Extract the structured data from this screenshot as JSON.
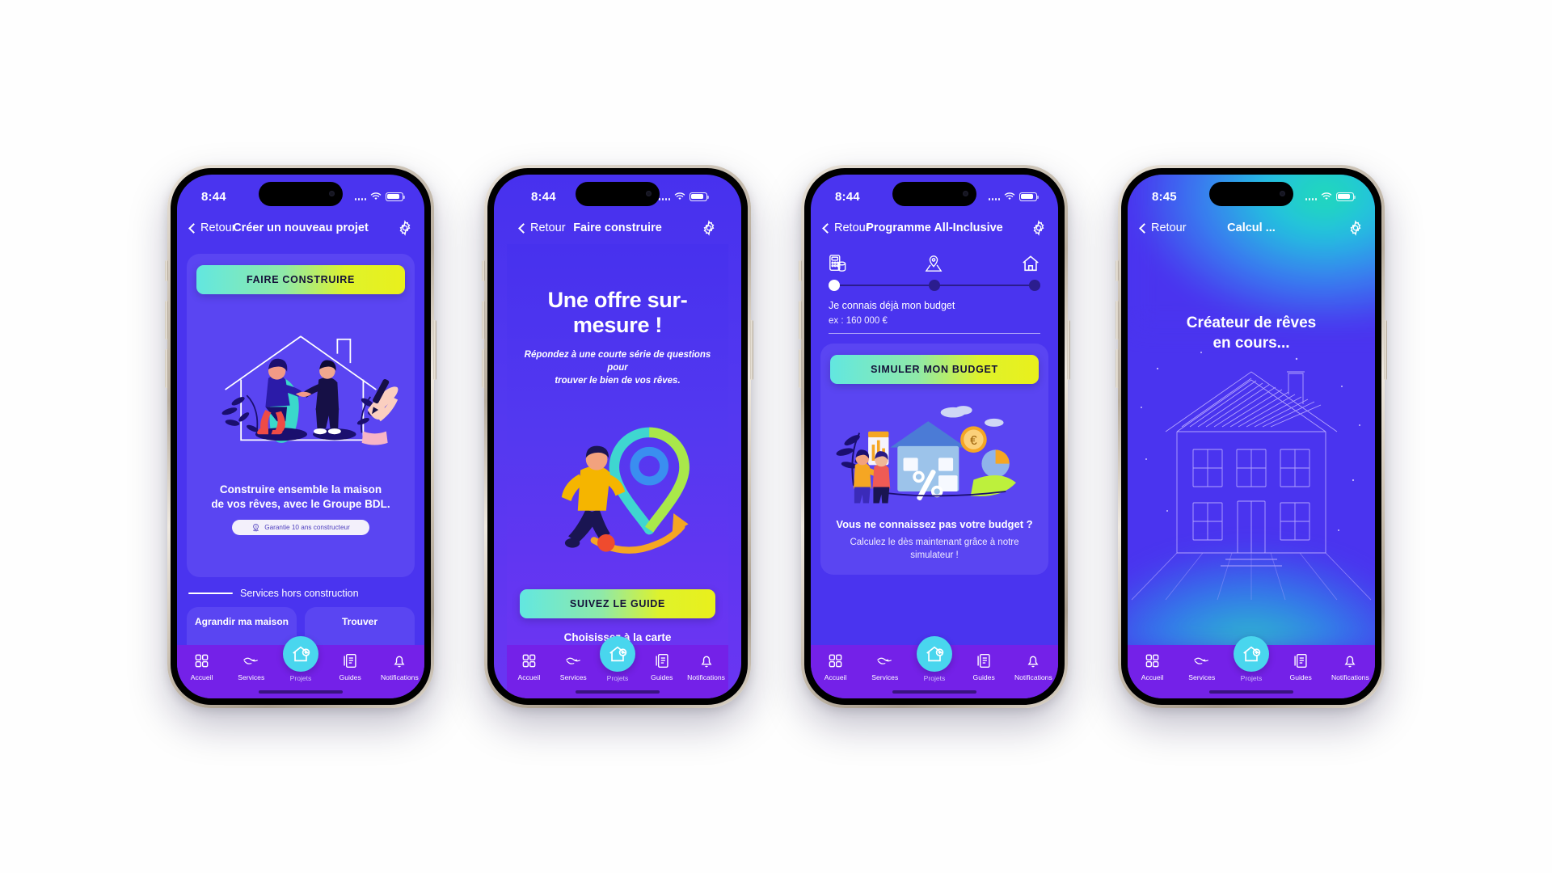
{
  "tabbar": {
    "items": [
      {
        "label": "Accueil",
        "icon": "grid-icon",
        "active": false
      },
      {
        "label": "Services",
        "icon": "handshake-icon",
        "active": false
      },
      {
        "label": "Projets",
        "icon": "house-plus-icon",
        "active": true
      },
      {
        "label": "Guides",
        "icon": "book-icon",
        "active": false
      },
      {
        "label": "Notifications",
        "icon": "bell-icon",
        "active": false
      }
    ],
    "background": "#7421e8",
    "active_bubble_color": "#49d6ee"
  },
  "common": {
    "back_label": "Retour",
    "settings_icon": "gear-icon",
    "back_icon": "chevron-left-icon",
    "wifi_icon": "wifi-icon",
    "battery_icon": "battery-icon"
  },
  "screens": [
    {
      "id": "creer-projet",
      "status_time": "8:44",
      "nav_title": "Créer un nouveau projet",
      "cta_label": "FAIRE CONSTRUIRE",
      "headline": "Construire ensemble la maison\nde vos rêves, avec le Groupe BDL.",
      "headline_line1": "Construire ensemble la maison",
      "headline_line2": "de vos rêves, avec le Groupe BDL.",
      "badge_label": "Garantie 10 ans constructeur",
      "badge_icon": "medal-10-icon",
      "section_divider": "Services hors construction",
      "tiles": [
        {
          "label": "Agrandir ma maison"
        },
        {
          "label": "Trouver"
        }
      ]
    },
    {
      "id": "faire-construire",
      "status_time": "8:44",
      "nav_title": "Faire construire",
      "headline": "Une offre sur-mesure !",
      "subtitle_line1": "Répondez à une courte série de questions pour",
      "subtitle_line2": "trouver le bien de vos rêves.",
      "cta_label": "SUIVEZ LE GUIDE",
      "link_label": "Choisissez à la carte",
      "illustration": "runner-map-pin-illustration"
    },
    {
      "id": "all-inclusive",
      "status_time": "8:44",
      "nav_title": "Programme All-Inclusive",
      "stepper": {
        "icons": [
          "calculator-icon",
          "map-pin-icon",
          "house-icon"
        ],
        "active_index": 0,
        "steps": 3
      },
      "budget_label": "Je connais déjà mon budget",
      "budget_example": "ex : 160 000 €",
      "cta_label": "SIMULER MON BUDGET",
      "card_headline": "Vous ne connaissez pas votre budget ?",
      "card_text_line1": "Calculez le dès maintenant grâce à notre",
      "card_text_line2": "simulateur !",
      "illustration": "house-budget-illustration"
    },
    {
      "id": "calcul",
      "status_time": "8:45",
      "nav_title": "Calcul ...",
      "headline_line1": "Créateur de rêves",
      "headline_line2": "en cours...",
      "illustration": "wireframe-house-illustration"
    }
  ],
  "colors": {
    "screen_bg": "#4a34ef",
    "card_bg": "#5a45f2",
    "tabbar_bg": "#7421e8",
    "cta_gradient_start": "#62e7e0",
    "cta_gradient_end": "#e9f01c",
    "accent_cyan": "#49d6ee",
    "page_bg": "#ffffff"
  }
}
